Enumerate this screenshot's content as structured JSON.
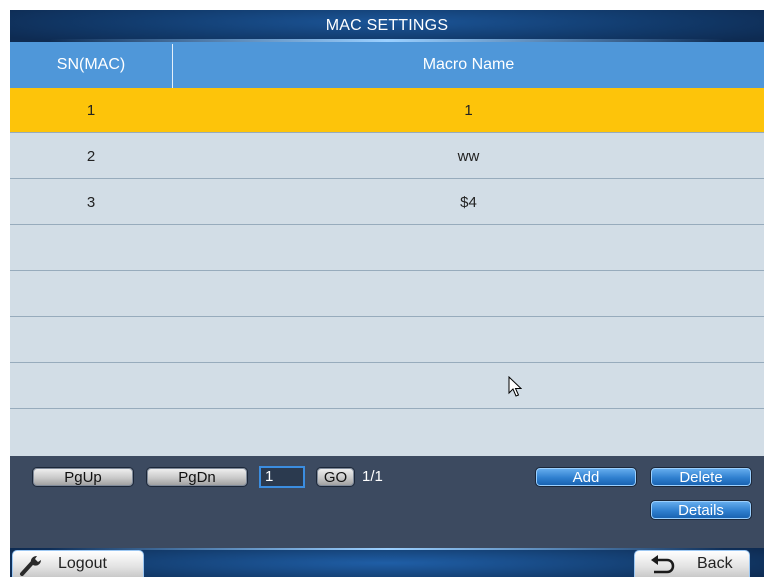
{
  "title": "MAC SETTINGS",
  "table": {
    "columns": [
      "SN(MAC)",
      "Macro Name"
    ],
    "rows": [
      {
        "sn": "1",
        "name": "1",
        "selected": true
      },
      {
        "sn": "2",
        "name": "ww"
      },
      {
        "sn": "3",
        "name": "$4"
      },
      {
        "sn": "",
        "name": ""
      },
      {
        "sn": "",
        "name": ""
      },
      {
        "sn": "",
        "name": ""
      },
      {
        "sn": "",
        "name": ""
      },
      {
        "sn": "",
        "name": ""
      }
    ]
  },
  "pager": {
    "pgup_label": "PgUp",
    "pgdn_label": "PgDn",
    "page_value": "1",
    "go_label": "GO",
    "page_info": "1/1"
  },
  "actions": {
    "add_label": "Add",
    "delete_label": "Delete",
    "details_label": "Details"
  },
  "footer": {
    "logout_label": "Logout",
    "back_label": "Back"
  },
  "icons": {
    "logout": "tool-icon",
    "back": "return-arrow-icon",
    "cursor": "mouse-pointer-icon"
  },
  "colors": {
    "header": "#4f97d9",
    "selected_row": "#fdc40a",
    "row_bg": "#d2dde6",
    "panel": "#3c4a60",
    "titlebar": "#0e2b52"
  }
}
